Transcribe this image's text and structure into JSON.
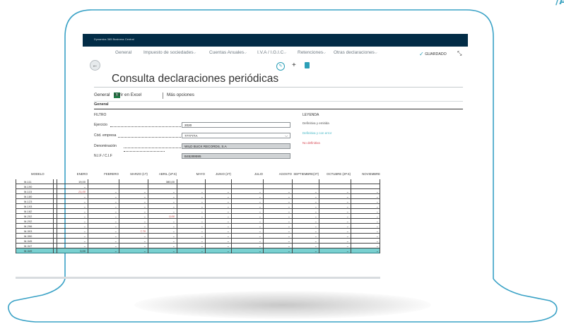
{
  "app": {
    "title": "Dynamics 365 Business Central"
  },
  "nav": {
    "items": [
      "General",
      "Impuesto de sociedades",
      "Cuentas Anuales",
      "I.V.A / I.G.I.C",
      "Retenciones",
      "Otras declaraciones"
    ],
    "saved": "GUARDADO"
  },
  "page": {
    "title": "Consulta declaraciones periódicas"
  },
  "actions": {
    "general": "General",
    "excel": "Abrir en Excel",
    "more": "Más opciones"
  },
  "section": "General",
  "filter": {
    "heading": "FILTRO",
    "ejercicio_label": "Ejercicio",
    "ejercicio_value": "2020",
    "empresa_label": "Cód. empresa",
    "empresa_value": "777777A",
    "denominacion_label": "Denominación",
    "denominacion_value": "WILD BUCK RECORDS, S.A",
    "nif_label": "N.I.F / C.I.F",
    "nif_value": "B45289595"
  },
  "legend": {
    "heading": "LEYENDA",
    "items": [
      {
        "label": "Definitiva y emitida",
        "color": "#555555"
      },
      {
        "label": "Definitiva y con error",
        "color": "#3fb5c4"
      },
      {
        "label": "No definitiva",
        "color": "#d64550"
      }
    ]
  },
  "table": {
    "columns": [
      "MODELO",
      "ENERO",
      "FEBRERO",
      "MARZO (1T)",
      "ABRIL (1P.S)",
      "MAYO",
      "JUNIO (2T)",
      "JULIO",
      "AGOSTO",
      "SEPTIEMBRE(3T)",
      "OCTUBRE (2P.S)",
      "NOVIEMBRE"
    ],
    "rows": [
      {
        "model": "M-111",
        "values": [
          "19,00",
          "",
          "",
          "380,00",
          "",
          "",
          "",
          "",
          "",
          "",
          ""
        ]
      },
      {
        "model": "M-190",
        "values": [
          "–",
          "",
          "",
          "",
          "",
          "",
          "",
          "",
          "",
          "",
          ""
        ]
      },
      {
        "model": "M-115",
        "values": [
          "21,00",
          "–",
          "–",
          "–",
          "–",
          "–",
          "–",
          "–",
          "–",
          "–",
          "–"
        ]
      },
      {
        "model": "M-180",
        "values": [
          "–",
          "–",
          "–",
          "–",
          "–",
          "–",
          "–",
          "–",
          "–",
          "–",
          "–"
        ]
      },
      {
        "model": "M-123",
        "values": [
          "–",
          "–",
          "–",
          "–",
          "–",
          "–",
          "–",
          "–",
          "–",
          "–",
          "–"
        ]
      },
      {
        "model": "M-193",
        "values": [
          "–",
          "–",
          "–",
          "–",
          "–",
          "–",
          "–",
          "–",
          "–",
          "–",
          "–"
        ]
      },
      {
        "model": "M-182",
        "values": [
          "–",
          "–",
          "–",
          "–",
          "–",
          "–",
          "–",
          "–",
          "–",
          "–",
          "–"
        ]
      },
      {
        "model": "M-202",
        "values": [
          "–",
          "–",
          "–",
          "0,00",
          "–",
          "–",
          "–",
          "–",
          "–",
          "–",
          "–"
        ]
      },
      {
        "model": "M-202",
        "values": [
          "–",
          "–",
          "–",
          "–",
          "–",
          "–",
          "–",
          "–",
          "–",
          "–",
          "–"
        ]
      },
      {
        "model": "M-296",
        "values": [
          "–",
          "–",
          "–",
          "–",
          "–",
          "–",
          "–",
          "–",
          "–",
          "–",
          "–"
        ]
      },
      {
        "model": "M-303",
        "values": [
          "–",
          "–",
          "7,70",
          "–",
          "–",
          "–",
          "–",
          "–",
          "–",
          "–",
          "–"
        ]
      },
      {
        "model": "M-390",
        "values": [
          "–",
          "–",
          "–",
          "–",
          "–",
          "–",
          "–",
          "–",
          "–",
          "–",
          "–"
        ]
      },
      {
        "model": "M-345",
        "values": [
          "–",
          "–",
          "–",
          "–",
          "–",
          "–",
          "–",
          "–",
          "–",
          "–",
          "–"
        ]
      },
      {
        "model": "M-347",
        "values": [
          "–",
          "–",
          "–",
          "–",
          "–",
          "–",
          "–",
          "–",
          "–",
          "–",
          "–"
        ]
      },
      {
        "model": "M-349",
        "values": [
          "0,00",
          "–",
          "–",
          "–",
          "–",
          "–",
          "–",
          "–",
          "–",
          "–",
          "–"
        ]
      }
    ],
    "red_cells": [
      "2-0",
      "7-3",
      "10-2"
    ]
  }
}
